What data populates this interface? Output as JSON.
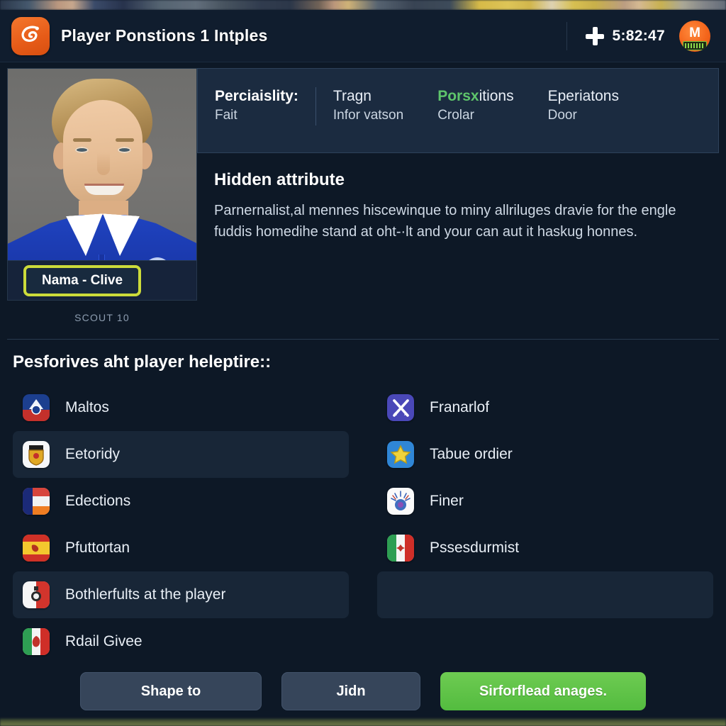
{
  "header": {
    "title": "Player Ponstions 1 Intples",
    "logo_icon": "app-swirl-logo-icon",
    "plus_icon": "plus-icon",
    "timer": "5:82:47",
    "avatar_icon": "user-avatar-badge"
  },
  "player": {
    "photo_alt": "player-portrait",
    "name_pill": "Nama - Clive",
    "scout_label": "SCOUT 10"
  },
  "tabs": [
    {
      "line1": "Perciaislity:",
      "line2": "Fait",
      "primary": true,
      "accent": false
    },
    {
      "line1": "Tragn",
      "line2": "Infor vatson",
      "primary": false,
      "accent": false
    },
    {
      "line1": "Porsxitions",
      "line1_accent": "Porsx",
      "line1_rest": "itions",
      "line2": "Crolar",
      "primary": false,
      "accent": true
    },
    {
      "line1": "Eperiatons",
      "line2": "Door",
      "primary": false,
      "accent": false
    }
  ],
  "attribute": {
    "title": "Hidden attribute",
    "body": "Parnernalist,al mennes hiscewinque to miny allriluges dravie for the engle fuddis homedihe stand at oht-·lt and your can aut it haskug honnes."
  },
  "section": {
    "heading": "Pesforives aht player heleptire::"
  },
  "list_left": [
    {
      "label": "Maltos",
      "icon": "flag-badge-crest-blue-red",
      "highlight": false
    },
    {
      "label": "Eetoridy",
      "icon": "flag-badge-crest-gold-white",
      "highlight": true
    },
    {
      "label": "Edections",
      "icon": "flag-badge-tricolor-blue-orange",
      "highlight": false
    },
    {
      "label": "Pfuttortan",
      "icon": "flag-badge-spain-red-yellow",
      "highlight": false
    },
    {
      "label": "Bothlerfults at the player",
      "icon": "flag-badge-malta-red-white",
      "highlight": true
    },
    {
      "label": "Rdail Givee",
      "icon": "flag-badge-italy-green-red",
      "highlight": false
    }
  ],
  "list_right": [
    {
      "label": "Franarlof",
      "icon": "crossed-swords-icon",
      "highlight": false
    },
    {
      "label": "Tabue ordier",
      "icon": "gold-star-icon",
      "highlight": false
    },
    {
      "label": "Finer",
      "icon": "burst-emblem-icon",
      "highlight": false
    },
    {
      "label": "Pssesdurmist",
      "icon": "flag-badge-mexico",
      "highlight": false
    },
    {
      "label": "",
      "icon": "",
      "highlight": true
    }
  ],
  "buttons": {
    "left": "Shape to",
    "middle": "Jidn",
    "right": "Sirforflead anages."
  },
  "colors": {
    "page_bg": "#0d1826",
    "header_bg": "#101d2e",
    "panel_bg": "#1b2b40",
    "row_alt_bg": "#182637",
    "accent_green": "#5ec46b",
    "primary_button": "#5cc248",
    "name_pill_border": "#ccdb3a",
    "logo_orange": "#e65b18"
  }
}
